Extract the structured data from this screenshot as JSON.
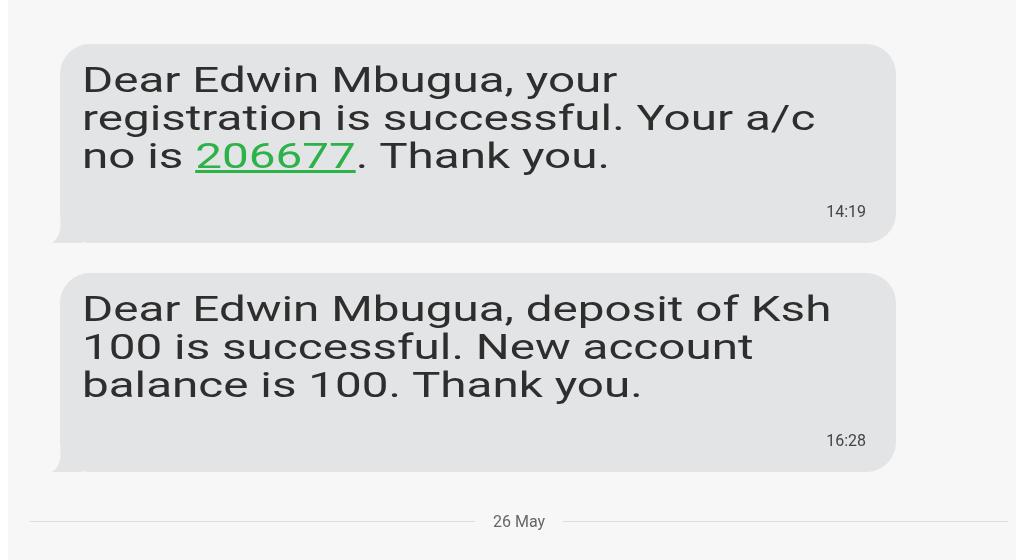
{
  "messages": [
    {
      "parts": [
        {
          "kind": "text",
          "text": "Dear Edwin Mbugua, your\nregistration is successful. Your a/c\nno is "
        },
        {
          "kind": "link",
          "text": "206677"
        },
        {
          "kind": "text",
          "text": ". Thank you."
        }
      ],
      "time": "14:19"
    },
    {
      "parts": [
        {
          "kind": "text",
          "text": "Dear Edwin Mbugua, deposit of Ksh\n100 is successful. New account\nbalance is 100. Thank you."
        }
      ],
      "time": "16:28"
    }
  ],
  "date_divider": "26 May"
}
